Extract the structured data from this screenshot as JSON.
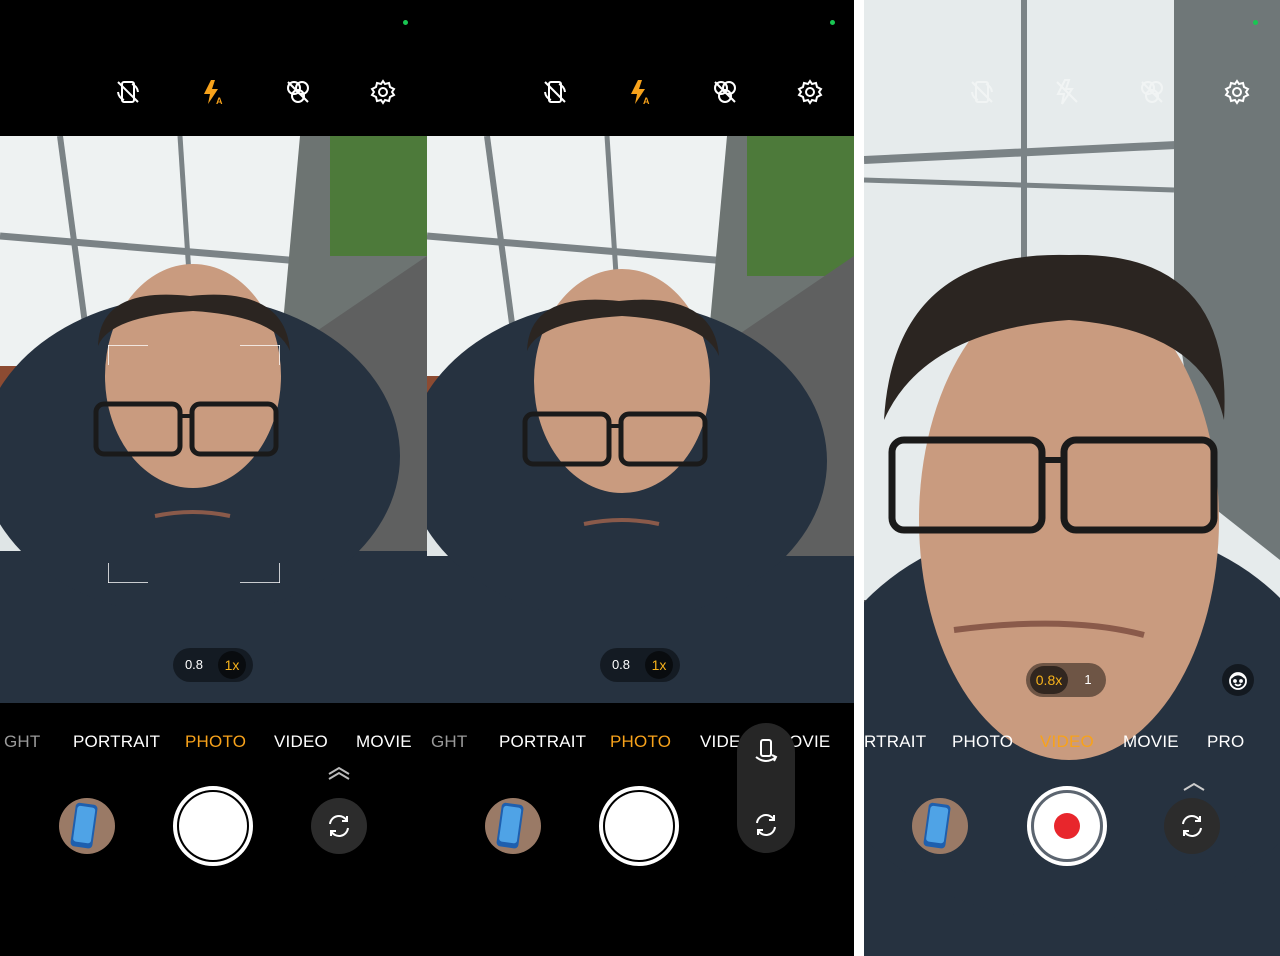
{
  "panels": [
    {
      "top_icons": [
        "selfie-mirror-icon",
        "flash-auto-icon",
        "beauty-off-icon",
        "settings-icon"
      ],
      "zoom": {
        "options": [
          "0.8",
          "1x"
        ],
        "active": "1x"
      },
      "modes": [
        "GHT",
        "PORTRAIT",
        "PHOTO",
        "VIDEO",
        "MOVIE"
      ],
      "active_mode": "PHOTO"
    },
    {
      "top_icons": [
        "selfie-mirror-icon",
        "flash-auto-icon",
        "beauty-off-icon",
        "settings-icon"
      ],
      "zoom": {
        "options": [
          "0.8",
          "1x"
        ],
        "active": "1x"
      },
      "modes": [
        "GHT",
        "PORTRAIT",
        "PHOTO",
        "VIDE",
        "OVIE"
      ],
      "active_mode": "PHOTO"
    },
    {
      "top_icons": [
        "selfie-mirror-icon",
        "flash-off-icon",
        "beauty-off-icon",
        "settings-icon"
      ],
      "zoom": {
        "options": [
          "0.8x",
          "1"
        ],
        "active": "0.8x"
      },
      "modes": [
        "RTRAIT",
        "PHOTO",
        "VIDEO",
        "MOVIE",
        "PRO"
      ],
      "active_mode": "VIDEO"
    }
  ],
  "colors": {
    "accent": "#f7a21b",
    "status_dot": "#19c652",
    "record": "#e8262c",
    "background": "#000000"
  }
}
